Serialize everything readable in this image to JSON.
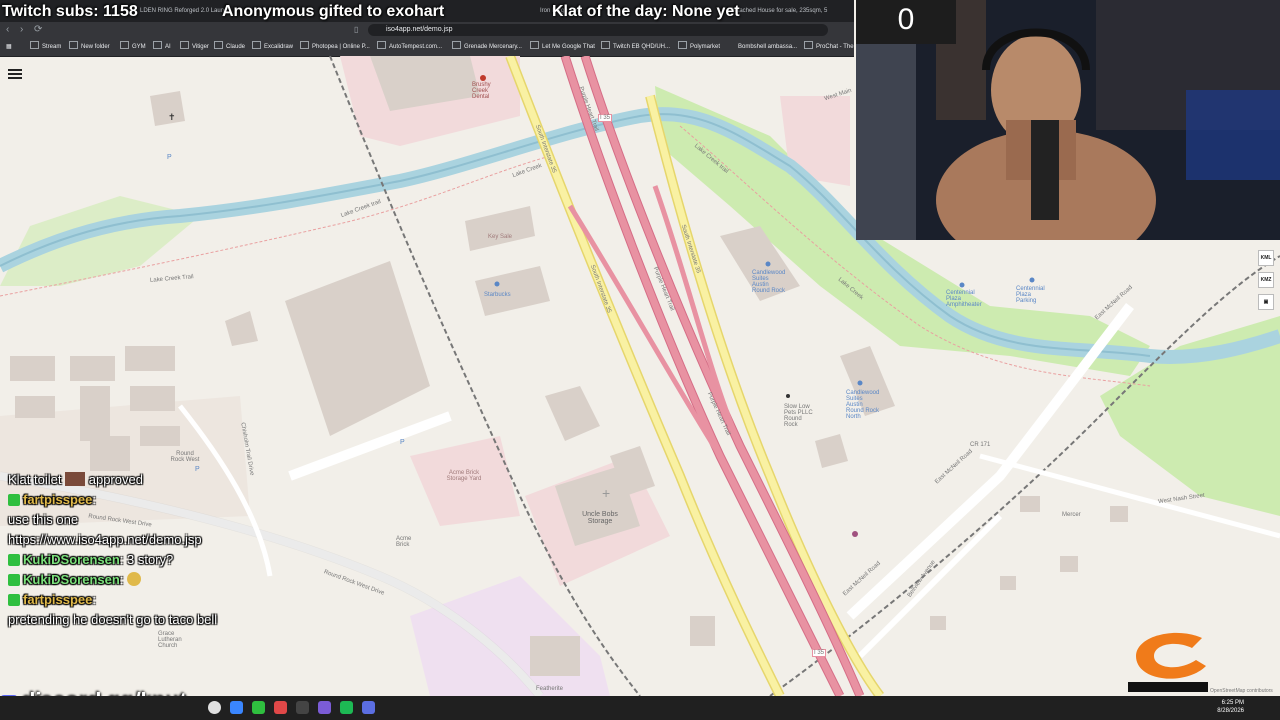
{
  "overlay": {
    "subs": "Twitch subs: 1158",
    "gift": "Anonymous gifted to exohart",
    "klat": "Klat of the day: None yet",
    "counter": "0",
    "discord": "discord.gg/knut"
  },
  "browser": {
    "url": "iso4app.net/demo.jsp",
    "tabs": [
      "LDEN RING Reforged 2.0 Launch",
      "Iron Forge Gym",
      "Detached House for sale, 235sqm, 5"
    ],
    "bookmarks": [
      "Stream",
      "New folder",
      "GYM",
      "AI",
      "Vitiger",
      "Claude",
      "Excalidraw",
      "Photopea | Online P...",
      "AutoTempest.com...",
      "Grenade Mercenary...",
      "Let Me Google That",
      "Twitch EB QHD/UH...",
      "Polymarket",
      "Bombshell ambassa...",
      "ProChat - The"
    ]
  },
  "map": {
    "labels": {
      "lake_creek_trail_1": "Lake Creek Trail",
      "lake_creek_trail_2": "Lake Creek trail",
      "lake_creek_trail_3": "Lake Creek trail",
      "lake_creek_1": "Lake Creek",
      "lake_creek_2": "Lake Creek",
      "i35_shield_1": "I 35",
      "i35_shield_2": "I 35",
      "south_i35_1": "South Interstate 35",
      "south_i35_2": "South Interstate 35",
      "south_i35_3": "South Interstate 35",
      "purple_heart_1": "Purple Heart Trail",
      "purple_heart_2": "Purple Heart Trail",
      "purple_heart_3": "Purple Heart Trail",
      "acme_brick_yard": "Acme Brick Storage Yard",
      "acme_brick": "Acme Brick",
      "uncle_bobs": "Uncle Bobs Storage",
      "round_rock_west": "Round Rock West",
      "round_rock_west_drive_1": "Round Rock West Drive",
      "round_rock_west_drive_2": "Round Rock West Drive",
      "chisholm_trail": "Chisholm Trail Drive",
      "brushy_dental": "Brushy Creek Dental",
      "key_sale": "Key Sale",
      "starbucks": "Starbucks",
      "candlewood_south": "Candlewood Suites Austin Round Rock",
      "candlewood_north": "Candlewood Suites Austin Round Rock North",
      "slow_low_pets": "Slow Low Pets PLLC Round Rock",
      "centennial_plaza": "Centennial Plaza Parking",
      "centennial_amph": "Centennial Plaza Amphitheater",
      "east_mcneil_1": "East McNeil Road",
      "east_mcneil_2": "East McNeil Road",
      "east_mcneil_3": "East McNeil Road",
      "cr171": "CR 171",
      "west_nash": "West Nash Street",
      "mercer": "Mercer",
      "bellview": "Bellview Avenue",
      "featherite": "Featherite",
      "grace_lutheran": "Grace Lutheran Church",
      "west_main": "West Main",
      "attribution": "OpenStreetMap contributors"
    },
    "controls": [
      "KML",
      "KMZ"
    ]
  },
  "chat": [
    {
      "user": "",
      "text": "Klat toilet",
      "suffix": "approved"
    },
    {
      "user": "fartpisspee",
      "text": ":"
    },
    {
      "user": "",
      "text": "use this one"
    },
    {
      "user": "",
      "text": "https://www.iso4app.net/demo.jsp"
    },
    {
      "user": "KukiDSorensen",
      "text": ": 3 story?"
    },
    {
      "user": "KukiDSorensen",
      "text": ":"
    },
    {
      "user": "fartpisspee",
      "text": ":"
    },
    {
      "user": "",
      "text": "pretending he doesn't go to taco bell"
    }
  ],
  "taskbar": {
    "time": "6:25 PM",
    "date": "8/28/2026"
  },
  "colors": {
    "water": "#aad3df",
    "highway": "#e892a2",
    "trunk": "#f9f1a3",
    "park": "#cdebb0",
    "building": "#d9d0c9",
    "background": "#f2efe9"
  }
}
